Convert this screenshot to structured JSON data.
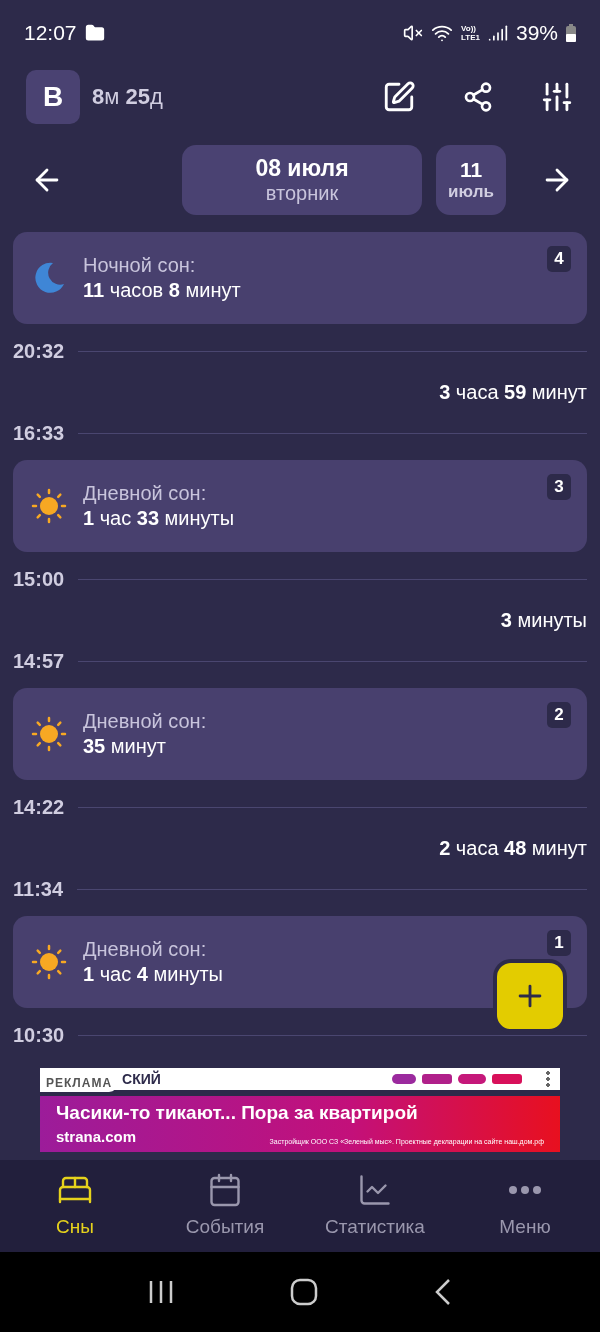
{
  "status_bar": {
    "time": "12:07",
    "volte_top": "Vo))",
    "volte_bottom": "LTE1",
    "battery": "39%"
  },
  "header": {
    "avatar": "B",
    "age": "**8**м **25**д"
  },
  "date_nav": {
    "date": "08 июля",
    "weekday": "вторник",
    "age_day": "11",
    "age_month": "июль"
  },
  "timeline": [
    {
      "kind": "night_sleep",
      "label": "Ночной сон:",
      "duration": "**11** часов **8** минут",
      "count": "4"
    },
    {
      "kind": "time",
      "time": "20:32"
    },
    {
      "kind": "gap",
      "duration": "**3** часа **59** минут"
    },
    {
      "kind": "time",
      "time": "16:33"
    },
    {
      "kind": "day_sleep",
      "label": "Дневной сон:",
      "duration": "**1** час **33** минуты",
      "count": "3"
    },
    {
      "kind": "time",
      "time": "15:00"
    },
    {
      "kind": "gap",
      "duration": "**3** минуты"
    },
    {
      "kind": "time",
      "time": "14:57"
    },
    {
      "kind": "day_sleep",
      "label": "Дневной сон:",
      "duration": "**35** минут",
      "count": "2"
    },
    {
      "kind": "time",
      "time": "14:22"
    },
    {
      "kind": "gap",
      "duration": "**2** часа **48** минут"
    },
    {
      "kind": "time",
      "time": "11:34"
    },
    {
      "kind": "day_sleep",
      "label": "Дневной сон:",
      "duration": "**1** час **4** минуты",
      "count": "1"
    },
    {
      "kind": "time",
      "time": "10:30"
    }
  ],
  "ad": {
    "badge": "РЕКЛАМА",
    "top_text": "СКИЙ",
    "headline": "Часики-то тикают... Пора за квартирой",
    "site": "strana.com",
    "fine_print": "Застройщик ООО СЗ «Зеленый мыс». Проектные декларации на сайте наш.дом.рф"
  },
  "bottom_nav": [
    {
      "label": "Сны",
      "selected": true
    },
    {
      "label": "События",
      "selected": false
    },
    {
      "label": "Статистика",
      "selected": false
    },
    {
      "label": "Меню",
      "selected": false
    }
  ]
}
